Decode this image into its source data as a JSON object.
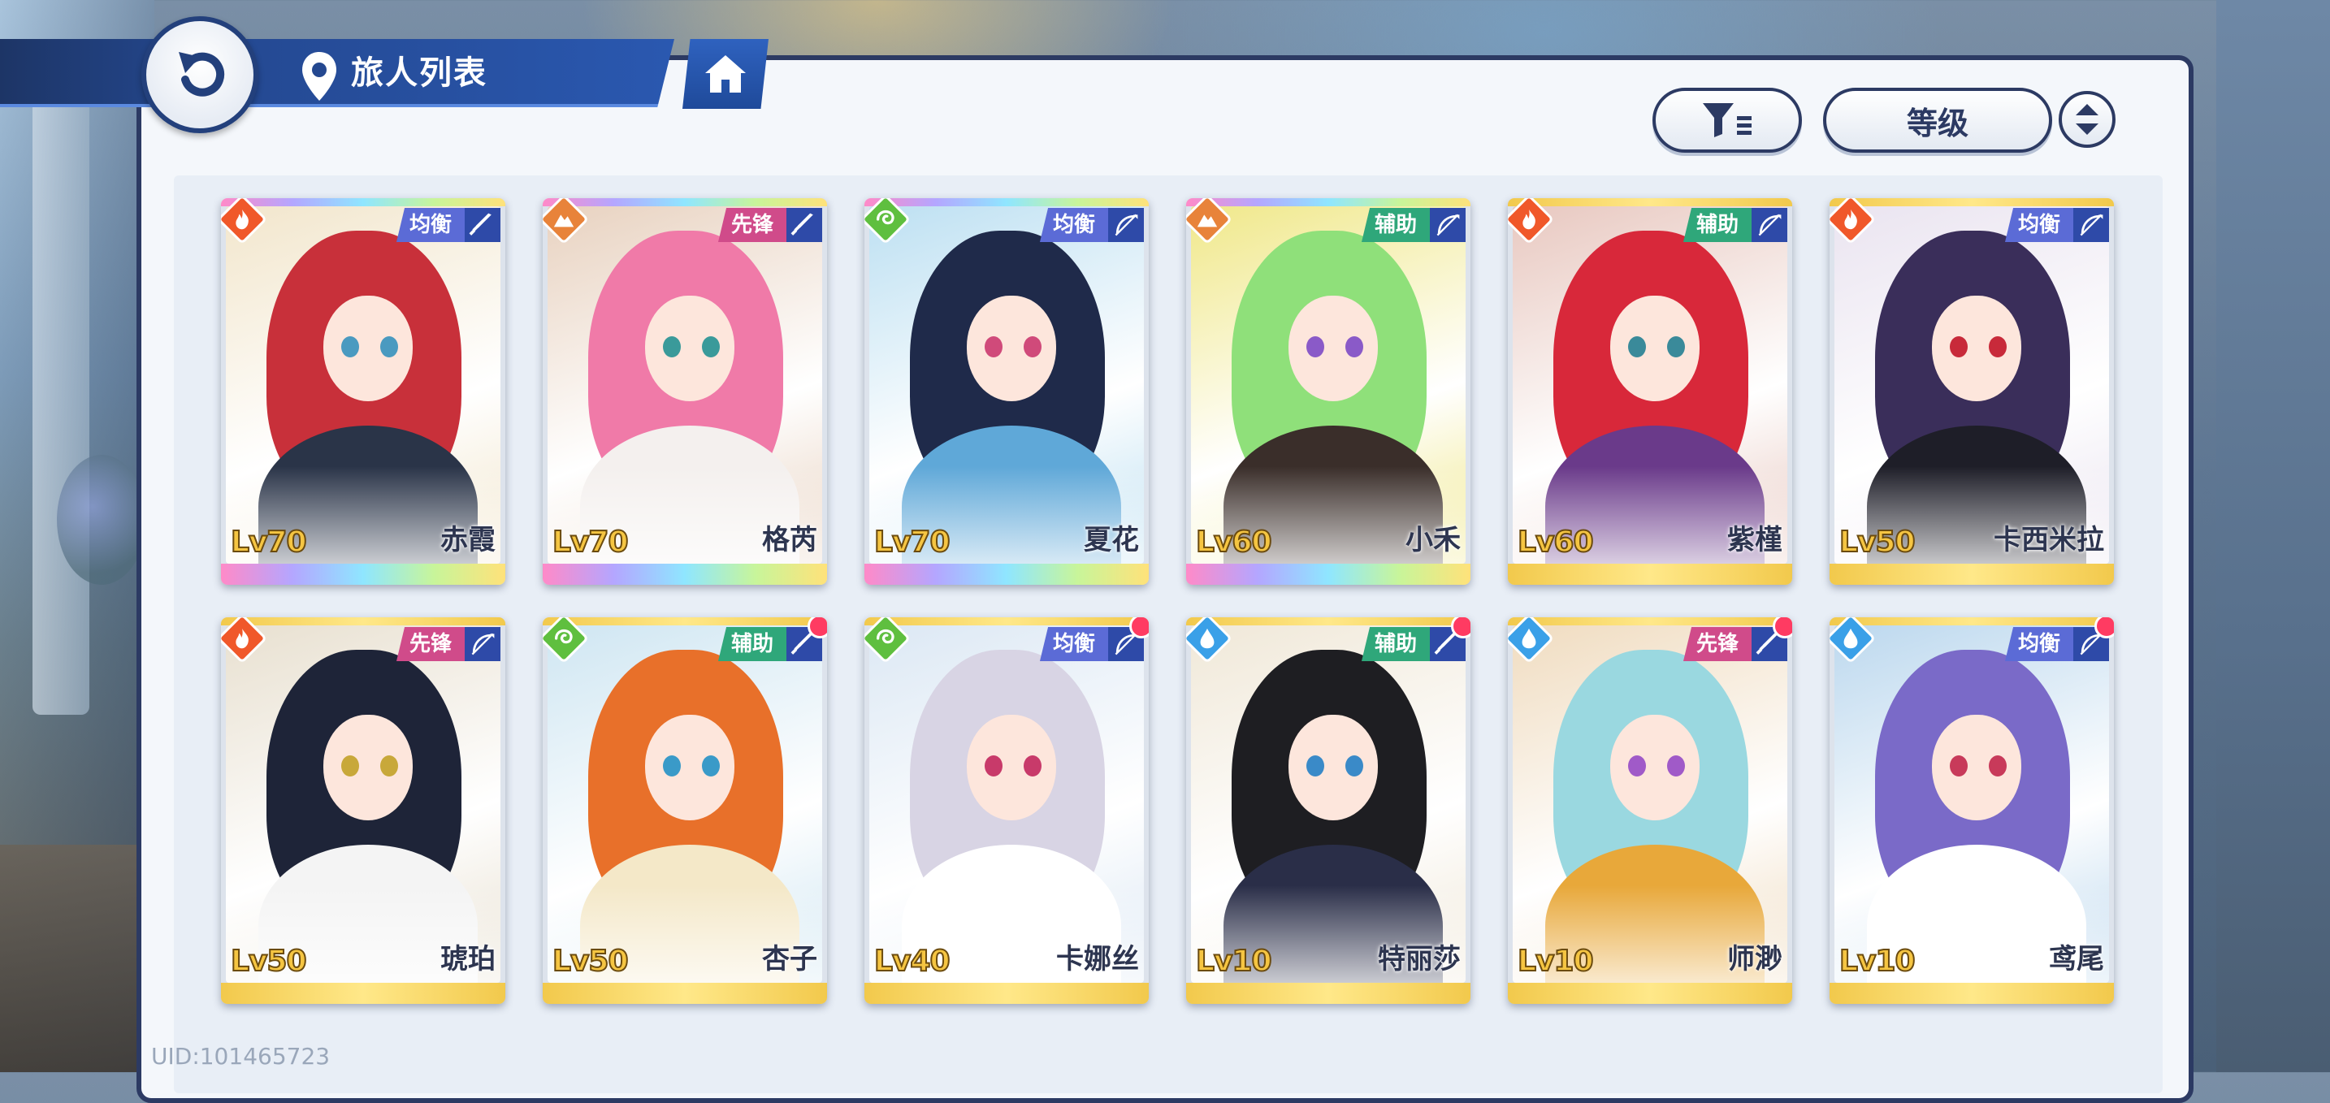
{
  "header": {
    "title": "旅人列表",
    "back_icon": "back-arrow-icon",
    "home_icon": "home-icon"
  },
  "controls": {
    "filter_icon": "filter-icon",
    "sort_label": "等级",
    "sort_order_icon": "sort-order-icon"
  },
  "colors": {
    "element_fire": "#f0582a",
    "element_earth": "#e8833a",
    "element_wind": "#5fbf3f",
    "element_water": "#3aa0e8",
    "role_support": "#2fa77a",
    "role_vanguard": "#d04b8a",
    "role_balance": "#5b6bd6",
    "panel_border": "#2c3a63"
  },
  "characters": [
    {
      "level": "Lv70",
      "name": "赤霞",
      "element": "fire",
      "role": "均衡",
      "role_type": "balance",
      "weapon": "sword",
      "rarity": "rainbow",
      "new": false,
      "palette": {
        "bg": "#f2e6cc",
        "hair": "#c8303a",
        "outfit": "#2a3448",
        "eye": "#4a9ac0"
      }
    },
    {
      "level": "Lv70",
      "name": "格芮",
      "element": "earth",
      "role": "先锋",
      "role_type": "vanguard",
      "weapon": "sword",
      "rarity": "rainbow",
      "new": false,
      "palette": {
        "bg": "#e8d2c0",
        "hair": "#f07aa8",
        "outfit": "#f4f0ee",
        "eye": "#3a9a9a"
      }
    },
    {
      "level": "Lv70",
      "name": "夏花",
      "element": "wind",
      "role": "均衡",
      "role_type": "balance",
      "weapon": "bow",
      "rarity": "rainbow",
      "new": false,
      "palette": {
        "bg": "#bde0f2",
        "hair": "#1f2a4a",
        "outfit": "#5fa8d8",
        "eye": "#d04a7a"
      }
    },
    {
      "level": "Lv60",
      "name": "小禾",
      "element": "earth",
      "role": "辅助",
      "role_type": "support",
      "weapon": "bow",
      "rarity": "rainbow",
      "new": false,
      "palette": {
        "bg": "#f0e88a",
        "hair": "#8fe07a",
        "outfit": "#3a2e2a",
        "eye": "#8a5ac8"
      }
    },
    {
      "level": "Lv60",
      "name": "紫槿",
      "element": "fire",
      "role": "辅助",
      "role_type": "support",
      "weapon": "bow",
      "rarity": "gold",
      "new": false,
      "palette": {
        "bg": "#e8c8c0",
        "hair": "#d8283a",
        "outfit": "#6a3a8a",
        "eye": "#3a8a9a"
      }
    },
    {
      "level": "Lv50",
      "name": "卡西米拉",
      "element": "fire",
      "role": "均衡",
      "role_type": "balance",
      "weapon": "bow",
      "rarity": "gold",
      "new": false,
      "palette": {
        "bg": "#eae4f0",
        "hair": "#3a2e5a",
        "outfit": "#1e1e28",
        "eye": "#c82a3a"
      }
    },
    {
      "level": "Lv50",
      "name": "琥珀",
      "element": "fire",
      "role": "先锋",
      "role_type": "vanguard",
      "weapon": "bow",
      "rarity": "gold",
      "new": false,
      "palette": {
        "bg": "#e8e0d0",
        "hair": "#1e2438",
        "outfit": "#f4f4f4",
        "eye": "#c8a83a"
      }
    },
    {
      "level": "Lv50",
      "name": "杏子",
      "element": "wind",
      "role": "辅助",
      "role_type": "support",
      "weapon": "sword",
      "rarity": "gold",
      "new": true,
      "palette": {
        "bg": "#cfe6f2",
        "hair": "#e8702a",
        "outfit": "#f4e8c8",
        "eye": "#3a9ac8"
      }
    },
    {
      "level": "Lv40",
      "name": "卡娜丝",
      "element": "wind",
      "role": "均衡",
      "role_type": "balance",
      "weapon": "bow",
      "rarity": "gold",
      "new": true,
      "palette": {
        "bg": "#dce8f4",
        "hair": "#d8d4e4",
        "outfit": "#ffffff",
        "eye": "#c83a6a"
      }
    },
    {
      "level": "Lv10",
      "name": "特丽莎",
      "element": "water",
      "role": "辅助",
      "role_type": "support",
      "weapon": "sword",
      "rarity": "gold",
      "new": true,
      "palette": {
        "bg": "#f0e8d8",
        "hair": "#1e1e22",
        "outfit": "#2a2e48",
        "eye": "#3a8ac8"
      }
    },
    {
      "level": "Lv10",
      "name": "师渺",
      "element": "water",
      "role": "先锋",
      "role_type": "vanguard",
      "weapon": "sword",
      "rarity": "gold",
      "new": true,
      "palette": {
        "bg": "#f0dcc0",
        "hair": "#9ad8e0",
        "outfit": "#e8a83a",
        "eye": "#a05ac8"
      }
    },
    {
      "level": "Lv10",
      "name": "鸢尾",
      "element": "water",
      "role": "均衡",
      "role_type": "balance",
      "weapon": "bow",
      "rarity": "gold",
      "new": true,
      "palette": {
        "bg": "#bcd8ee",
        "hair": "#7a6ac8",
        "outfit": "#ffffff",
        "eye": "#c83a5a"
      }
    }
  ],
  "footer": {
    "uid": "UID:101465723"
  }
}
